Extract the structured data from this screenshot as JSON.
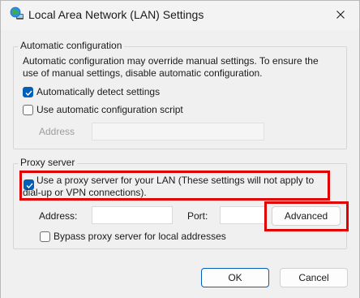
{
  "window": {
    "title": "Local Area Network (LAN) Settings",
    "icons": {
      "app": "network-globe-icon",
      "close": "close-icon"
    }
  },
  "auto_config": {
    "legend": "Automatic configuration",
    "description_line1": "Automatic configuration may override manual settings.  To ensure the",
    "description_line2": "use of manual settings, disable automatic configuration.",
    "auto_detect": {
      "label": "Automatically detect settings",
      "checked": true
    },
    "use_script": {
      "label": "Use automatic configuration script",
      "checked": false
    },
    "address_label": "Address",
    "address_value": ""
  },
  "proxy": {
    "legend": "Proxy server",
    "use_proxy": {
      "label_line1": "Use a proxy server for your LAN (These settings will not apply to",
      "label_line2": "dial-up or VPN connections).",
      "checked": true
    },
    "address_label": "Address:",
    "address_value": "",
    "port_label": "Port:",
    "port_value": "",
    "advanced_label": "Advanced",
    "bypass": {
      "label": "Bypass proxy server for local addresses",
      "checked": false
    }
  },
  "buttons": {
    "ok": "OK",
    "cancel": "Cancel"
  },
  "colors": {
    "accent": "#005fb8",
    "highlight": "#e00000",
    "background": "#f0f0f0"
  }
}
